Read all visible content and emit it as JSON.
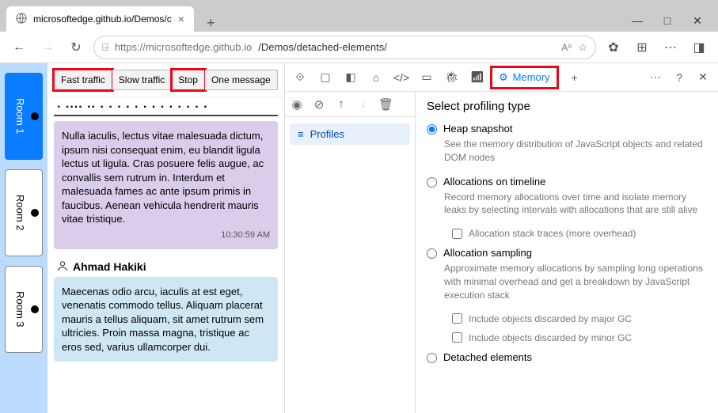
{
  "window": {
    "tab_title": "microsoftedge.github.io/Demos/c"
  },
  "url": {
    "lock": "🔒",
    "prefix": "https://microsoftedge.github.io",
    "path": "/Demos/detached-elements/"
  },
  "rooms": [
    {
      "label": "Room 1",
      "active": true
    },
    {
      "label": "Room 2",
      "active": false
    },
    {
      "label": "Room 3",
      "active": false
    }
  ],
  "traffic_buttons": {
    "fast": "Fast traffic",
    "slow": "Slow traffic",
    "stop": "Stop",
    "one": "One message"
  },
  "messages": [
    {
      "kind": "purple",
      "text": "Nulla iaculis, lectus vitae malesuada dictum, ipsum nisi consequat enim, eu blandit ligula lectus ut ligula. Cras posuere felis augue, ac convallis sem rutrum in. Interdum et malesuada fames ac ante ipsum primis in faucibus. Aenean vehicula hendrerit mauris vitae tristique.",
      "time": "10:30:59 AM"
    },
    {
      "author": "Ahmad Hakiki",
      "kind": "blue",
      "text": "Maecenas odio arcu, iaculis at est eget, venenatis commodo tellus. Aliquam placerat mauris a tellus aliquam, sit amet rutrum sem ultricies. Proin massa magna, tristique ac eros sed, varius ullamcorper dui."
    }
  ],
  "devtools": {
    "memory_tab": "Memory",
    "profiles_label": "Profiles",
    "section_title": "Select profiling type",
    "options": {
      "heap": {
        "label": "Heap snapshot",
        "desc": "See the memory distribution of JavaScript objects and related DOM nodes"
      },
      "timeline": {
        "label": "Allocations on timeline",
        "desc": "Record memory allocations over time and isolate memory leaks by selecting intervals with allocations that are still alive"
      },
      "timeline_check": "Allocation stack traces (more overhead)",
      "sampling": {
        "label": "Allocation sampling",
        "desc": "Approximate memory allocations by sampling long operations with minimal overhead and get a breakdown by JavaScript execution stack"
      },
      "sampling_check1": "Include objects discarded by major GC",
      "sampling_check2": "Include objects discarded by minor GC",
      "detached": {
        "label": "Detached elements"
      }
    }
  }
}
